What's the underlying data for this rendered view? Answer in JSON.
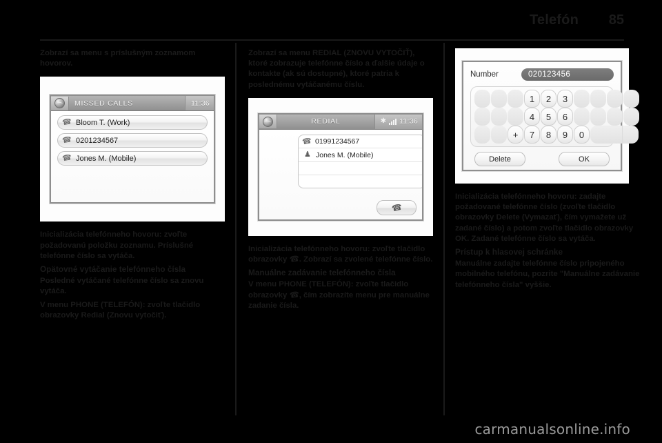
{
  "header": {
    "title": "Telefón",
    "page_number": "85"
  },
  "columns": {
    "left": {
      "intro": "Zobrazí sa menu s príslušným zoznamom hovorov.",
      "para_init_heading": "Inicializácia telefónneho hovoru:",
      "para_init_body": "zvoľte požadovanú položku zoznamu. Príslušné telefónne číslo sa vytáča.",
      "heading_redial": "Opätovné vytáčanie telefónneho čísla",
      "para_redial": "Posledné vytáčané telefónne číslo sa znovu vytáča.",
      "para_menu_phone": "V menu PHONE (TELEFÓN): zvoľte tlačidlo obrazovky Redial (Znovu vytočiť)."
    },
    "middle": {
      "intro": "Zobrazí sa menu REDIAL (ZNOVU VYTOČIŤ), ktoré zobrazuje telefónne číslo a ďalšie údaje o kontakte (ak sú dostupné), ktoré patria k poslednému vytáčanému číslu.",
      "para_init_heading": "Inicializácia telefónneho hovoru:",
      "para_init_body_a": "zvoľte tlačidlo obrazovky",
      "para_init_body_b": ". Zobrazí sa zvolené telefónne číslo.",
      "heading_manual": "Manuálne zadávanie telefónneho čísla",
      "para_manual_a": "V menu PHONE (TELEFÓN): zvoľte tlačidlo obrazovky",
      "para_manual_b": ", čím zobrazíte menu pre manuálne zadanie čísla."
    },
    "right": {
      "para_init_heading": "Inicializácia telefónneho hovoru:",
      "para_init_body": "zadajte požadované telefónne číslo (zvoľte tlačidlo obrazovky Delete (Vymazať), čím vymažete už zadané číslo) a potom zvoľte tlačidlo obrazovky OK. Zadané telefónne číslo sa vytáča.",
      "heading_voicemail": "Prístup k hlasovej schránke",
      "para_voicemail": "Manuálne zadajte telefónne číslo pripojeného mobilného telefónu, pozrite \"Manuálne zadávanie telefónneho čísla\" vyššie."
    }
  },
  "figures": {
    "missed_calls": {
      "title": "MISSED CALLS",
      "clock": "11:36",
      "items": [
        {
          "icon": "handset-icon",
          "label": "Bloom T. (Work)"
        },
        {
          "icon": "handset-icon",
          "label": "0201234567"
        },
        {
          "icon": "handset-icon",
          "label": "Jones M. (Mobile)"
        }
      ]
    },
    "redial": {
      "title": "REDIAL",
      "clock": "11:36",
      "bluetooth_icon": "✱",
      "signal_icon": "signal-bars-icon",
      "rows": [
        {
          "icon": "handset-icon",
          "label": "01991234567"
        },
        {
          "icon": "headset-icon",
          "label": "Jones M. (Mobile)"
        }
      ],
      "call_button_icon": "call-handset-icon"
    },
    "keypad": {
      "number_label": "Number",
      "number_value": "020123456",
      "rows": [
        [
          "",
          "",
          "",
          "1",
          "2",
          "3",
          "",
          "",
          "",
          ""
        ],
        [
          "",
          "",
          "",
          "4",
          "5",
          "6",
          "",
          "",
          "",
          ""
        ],
        [
          "",
          "",
          "+",
          "7",
          "8",
          "9",
          "0",
          ""
        ]
      ],
      "delete_label": "Delete",
      "ok_label": "OK"
    }
  },
  "watermark": "carmanualsonline.info"
}
